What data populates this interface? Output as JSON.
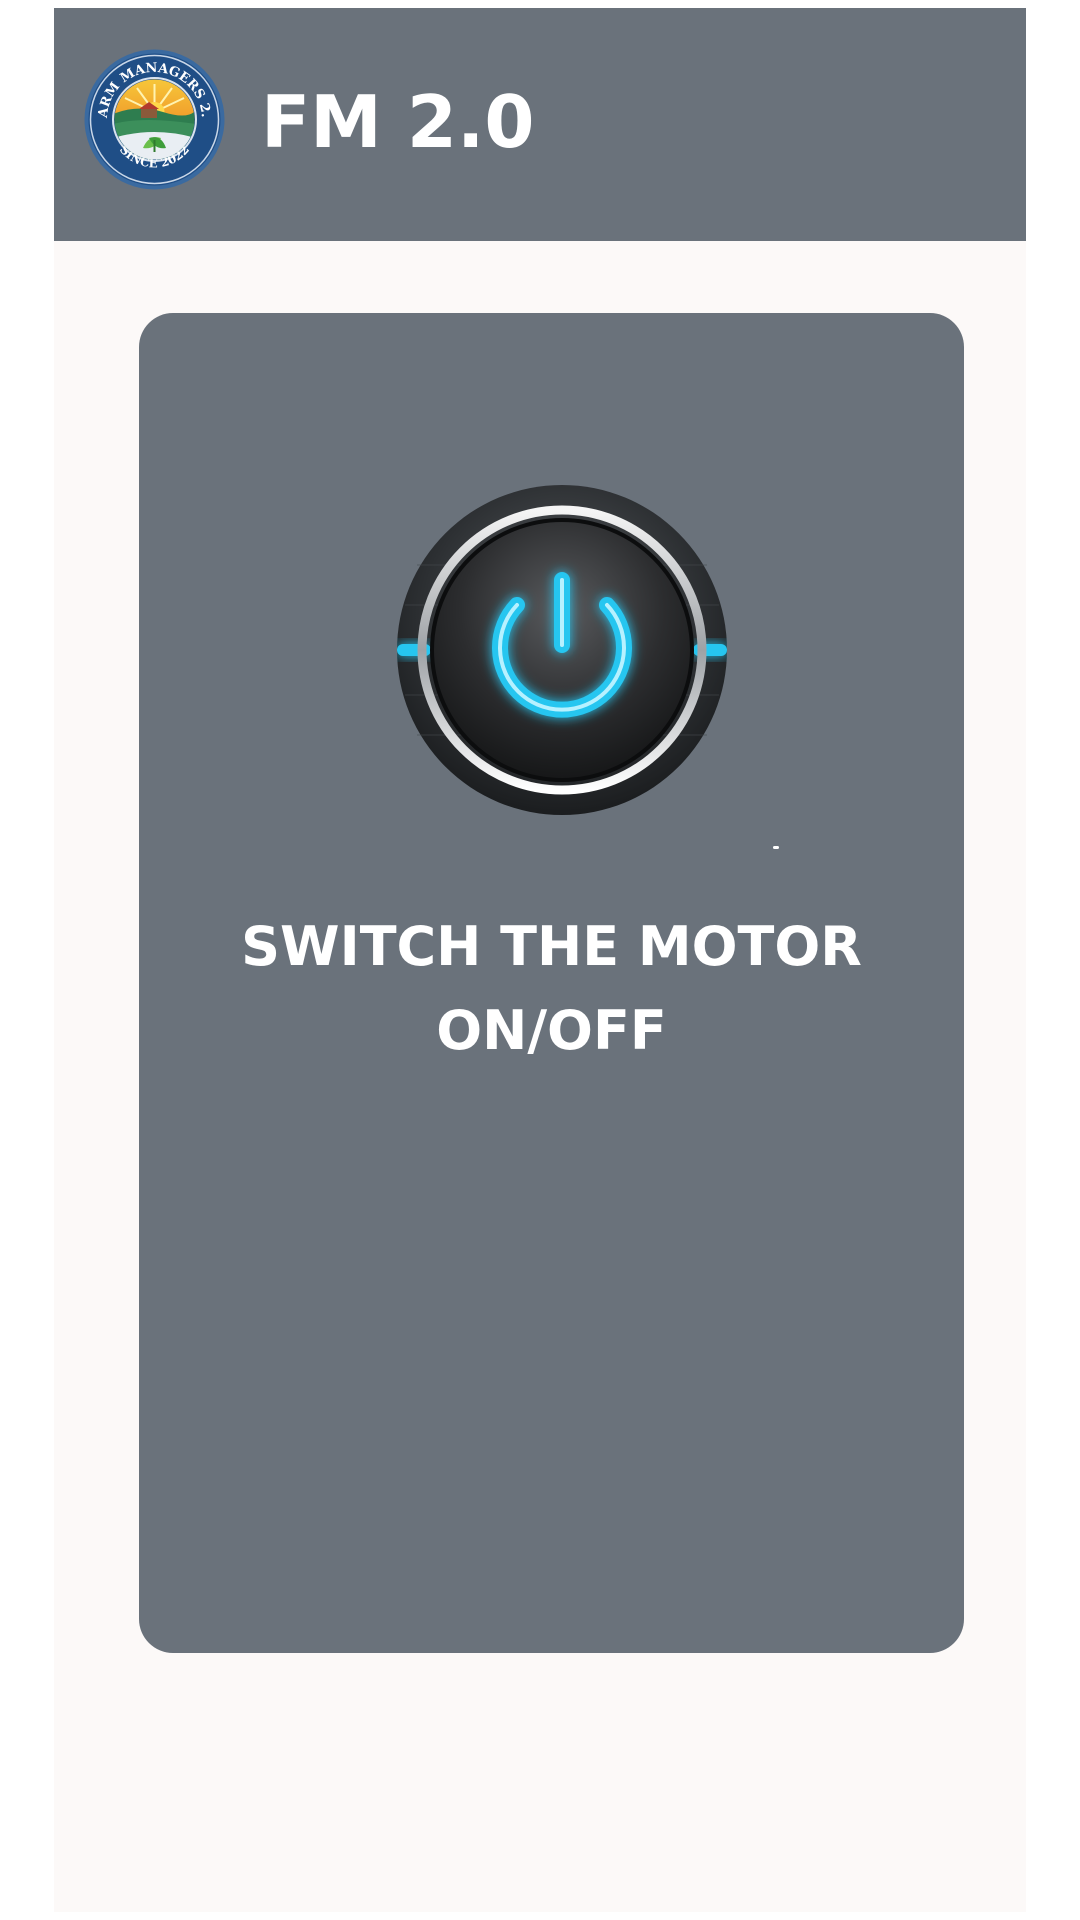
{
  "app": {
    "title": "FM 2.0",
    "logo": {
      "top_text": "FARM MANAGERS 2.0",
      "bottom_text": "SINCE 2022"
    }
  },
  "motor": {
    "caption_line1": "SWITCH THE MOTOR",
    "caption_line2": "ON/OFF",
    "button_icon": "power-icon"
  },
  "colors": {
    "header_bg": "#6a727b",
    "card_bg": "#6a727b",
    "page_bg": "#fcf9f8",
    "text": "#ffffff",
    "power_glow": "#26c6f0"
  }
}
